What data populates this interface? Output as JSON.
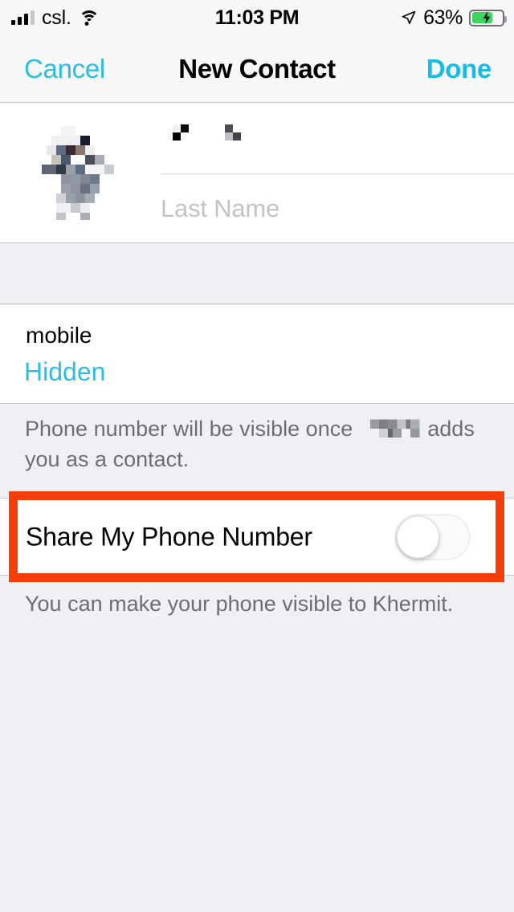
{
  "status_bar": {
    "carrier": "csl.",
    "time": "11:03 PM",
    "battery_percent": "63%",
    "battery_level": 63,
    "charging": true,
    "signal_bars_filled": 3,
    "signal_bars_total": 4,
    "wifi_icon": "wifi-icon",
    "location_icon": "location-arrow-icon",
    "battery_icon": "battery-charging-icon"
  },
  "nav_bar": {
    "cancel_label": "Cancel",
    "title": "New Contact",
    "done_label": "Done"
  },
  "name_section": {
    "avatar_icon": "contact-photo-redacted",
    "first_name_value": "",
    "first_name_redacted": true,
    "last_name_placeholder": "Last Name",
    "last_name_value": ""
  },
  "phone_section": {
    "label": "mobile",
    "value": "Hidden"
  },
  "footer_phone_visibility": {
    "text_before": "Phone number will be visible once",
    "redacted_name": true,
    "text_after": "adds you as a contact."
  },
  "share_toggle": {
    "label": "Share My Phone Number",
    "state": "off",
    "footer": "You can make your phone visible to Khermit."
  },
  "annotation": {
    "type": "highlight-rectangle",
    "target": "share-my-phone-number-row",
    "color": "#F63E0B"
  },
  "colors": {
    "tint": "#2CBDE0",
    "background": "#EFEFF4",
    "row_background": "#FFFFFF",
    "separator": "#C8C7CC",
    "secondary_text": "#6D6D72",
    "placeholder": "#C3C3C7",
    "battery_green": "#3BD45C",
    "annotation_red": "#F63E0B"
  }
}
